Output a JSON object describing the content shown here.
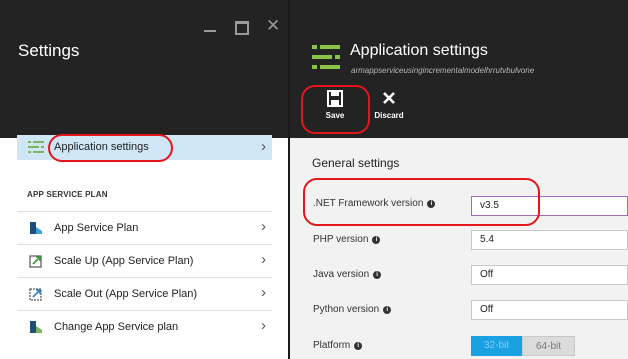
{
  "left_blade": {
    "title": "Settings",
    "window_controls": {
      "minimize": "minimize-icon",
      "maximize": "maximize-icon",
      "close": "close-icon"
    },
    "selected_item": {
      "label": "Application settings",
      "icon": "settings-lines-icon"
    },
    "section_label": "APP SERVICE PLAN",
    "items": [
      {
        "label": "App Service Plan",
        "icon": "app-service-plan-icon"
      },
      {
        "label": "Scale Up (App Service Plan)",
        "icon": "scale-up-icon"
      },
      {
        "label": "Scale Out (App Service Plan)",
        "icon": "scale-out-icon"
      },
      {
        "label": "Change App Service plan",
        "icon": "change-plan-icon"
      }
    ]
  },
  "right_blade": {
    "title": "Application settings",
    "subtitle": "armappserviceusingincrementalmodelhrrutvbulvone",
    "commands": {
      "save": "Save",
      "discard": "Discard"
    },
    "general_heading": "General settings",
    "settings": [
      {
        "label": ".NET Framework version",
        "value": "v3.5"
      },
      {
        "label": "PHP version",
        "value": "5.4"
      },
      {
        "label": "Java version",
        "value": "Off"
      },
      {
        "label": "Python version",
        "value": "Off"
      }
    ],
    "platform": {
      "label": "Platform",
      "options": [
        "32-bit",
        "64-bit"
      ],
      "selected": "32-bit"
    },
    "info_glyph": "i"
  },
  "colors": {
    "header_bg": "#232323",
    "selected_bg": "#cfe6f7",
    "accent": "#1ba1e2",
    "annotation": "#e3171b"
  }
}
